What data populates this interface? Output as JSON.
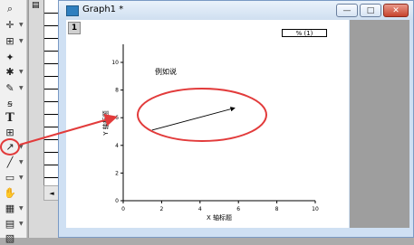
{
  "window": {
    "title": "Graph1 *",
    "btn_minimize": "—",
    "btn_maximize": "□",
    "btn_close": "✕"
  },
  "graph": {
    "layer_number": "1",
    "legend_text": "% (1)",
    "annotation_text": "例如说",
    "xlabel": "X 轴标题",
    "ylabel": "Y 轴标题",
    "xticks": [
      "0",
      "2",
      "4",
      "6",
      "8",
      "10"
    ],
    "yticks": [
      "0",
      "2",
      "4",
      "6",
      "8",
      "10"
    ],
    "xlim": [
      0,
      10
    ],
    "ylim": [
      0,
      10
    ],
    "arrow_from": [
      1.5,
      5.1
    ],
    "arrow_to": [
      5.8,
      6.7
    ]
  },
  "colors": {
    "highlight": "#e23b3b"
  },
  "toolbar": {
    "icons": [
      "zoom-icon",
      "crosshair-icon",
      "select-region-icon",
      "data-reader-icon",
      "mask-icon",
      "draw-data-icon",
      "text-icon",
      "text-tool-icon",
      "arrow-icon",
      "line-icon",
      "rectangle-icon",
      "hand-icon",
      "insert-graph-icon",
      "insert-chart-icon",
      "insert-data-icon"
    ]
  }
}
